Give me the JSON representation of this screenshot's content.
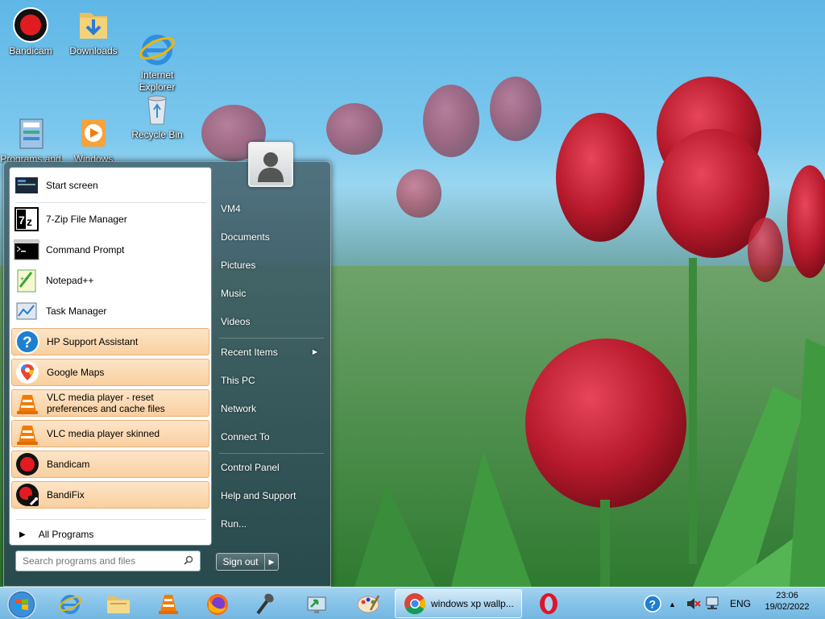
{
  "desktop": {
    "icons": [
      {
        "label": "Bandicam"
      },
      {
        "label": "Downloads"
      },
      {
        "label": "Internet\nExplorer"
      },
      {
        "label": "Programs and\nFeatures - S..."
      },
      {
        "label": "Windows\nMedia Player"
      },
      {
        "label": "Recycle Bin"
      }
    ]
  },
  "start_menu": {
    "left_items": [
      {
        "label": "Start screen"
      },
      {
        "label": "7-Zip File Manager"
      },
      {
        "label": "Command Prompt"
      },
      {
        "label": "Notepad++"
      },
      {
        "label": "Task Manager"
      },
      {
        "label": "HP Support Assistant"
      },
      {
        "label": "Google Maps"
      },
      {
        "label": "VLC media player - reset\npreferences and cache files"
      },
      {
        "label": "VLC media player skinned"
      },
      {
        "label": "Bandicam"
      },
      {
        "label": "BandiFix"
      }
    ],
    "all_programs": "All Programs",
    "search_placeholder": "Search programs and files",
    "right_items": [
      {
        "label": "VM4"
      },
      {
        "label": "Documents"
      },
      {
        "label": "Pictures"
      },
      {
        "label": "Music"
      },
      {
        "label": "Videos"
      },
      {
        "label": "Recent Items"
      },
      {
        "label": "This PC"
      },
      {
        "label": "Network"
      },
      {
        "label": "Connect To"
      },
      {
        "label": "Control Panel"
      },
      {
        "label": "Help and Support"
      },
      {
        "label": "Run..."
      }
    ],
    "sign_out": "Sign out"
  },
  "taskbar": {
    "active_task": "windows xp wallp...",
    "language": "ENG",
    "time": "23:06",
    "date": "19/02/2022"
  },
  "colors": {
    "highlight": "#f9cf9f",
    "taskbar": "#86c3e8"
  }
}
